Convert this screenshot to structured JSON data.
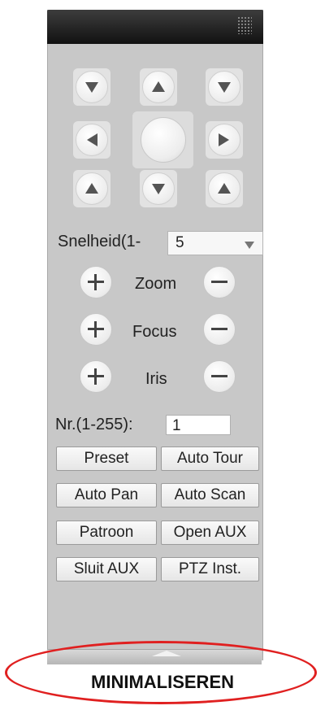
{
  "ptz": {
    "speed_label": "Snelheid(1-",
    "speed_value": "5",
    "zoom_label": "Zoom",
    "focus_label": "Focus",
    "iris_label": "Iris",
    "nr_label": "Nr.(1-255):",
    "nr_value": "1"
  },
  "actions": {
    "preset": "Preset",
    "auto_tour": "Auto Tour",
    "auto_pan": "Auto Pan",
    "auto_scan": "Auto Scan",
    "patroon": "Patroon",
    "open_aux": "Open AUX",
    "sluit_aux": "Sluit AUX",
    "ptz_inst": "PTZ Inst."
  },
  "annotation": {
    "label": "MINIMALISEREN",
    "color": "#e02020"
  },
  "icons": {
    "direction_pad": [
      "arrow-up-left-icon",
      "arrow-up-icon",
      "arrow-up-right-icon",
      "arrow-left-icon",
      "center-icon",
      "arrow-right-icon",
      "arrow-down-left-icon",
      "arrow-down-icon",
      "arrow-down-right-icon"
    ],
    "plus": "plus-icon",
    "minus": "minus-icon"
  }
}
